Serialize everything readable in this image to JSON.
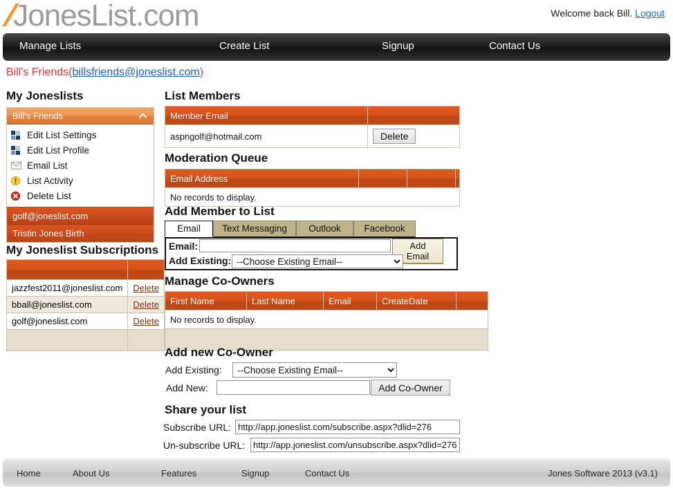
{
  "header": {
    "logo_slash": "/",
    "logo_name": "JonesList.com",
    "welcome_text": "Welcome back Bill.",
    "logout_label": "Logout"
  },
  "nav": {
    "items": [
      {
        "label": "Manage Lists"
      },
      {
        "label": "Create List"
      },
      {
        "label": "Signup"
      },
      {
        "label": "Contact Us"
      }
    ]
  },
  "page_title": {
    "name": "Bill's Friends",
    "open_paren": "(",
    "email": "billsfriends@joneslist.com",
    "close_paren": ")"
  },
  "sidebar": {
    "heading": "My Joneslists",
    "accordion": {
      "title": "Bill's Friends",
      "items": [
        {
          "label": "Edit List Settings",
          "icon": "grid-squares-icon"
        },
        {
          "label": "Edit List Profile",
          "icon": "grid-squares-icon"
        },
        {
          "label": "Email List",
          "icon": "envelope-icon"
        },
        {
          "label": "List Activity",
          "icon": "warning-icon"
        },
        {
          "label": "Delete List",
          "icon": "delete-circle-icon"
        }
      ],
      "sub_lists": [
        {
          "label": "golf@joneslist.com"
        },
        {
          "label": "Tristin Jones Birth"
        }
      ]
    },
    "subscriptions": {
      "heading": "My Joneslist Subscriptions",
      "header_email": "",
      "header_action": "",
      "rows": [
        {
          "email": "jazzfest2011@joneslist.com",
          "action": "Delete"
        },
        {
          "email": "bball@joneslist.com",
          "action": "Delete"
        },
        {
          "email": "golf@joneslist.com",
          "action": "Delete"
        }
      ]
    }
  },
  "main": {
    "list_members": {
      "heading": "List Members",
      "columns": [
        "Member Email",
        ""
      ],
      "rows": [
        {
          "email": "aspngolf@hotmail.com",
          "action": "Delete"
        }
      ]
    },
    "moderation_queue": {
      "heading": "Moderation Queue",
      "columns": [
        "Email Address",
        "",
        "",
        ""
      ],
      "empty_text": "No records to display."
    },
    "add_member": {
      "heading": "Add Member to List",
      "tabs": [
        {
          "label": "Email",
          "active": true
        },
        {
          "label": "Text Messaging",
          "active": false
        },
        {
          "label": "Outlook",
          "active": false
        },
        {
          "label": "Facebook",
          "active": false
        }
      ],
      "email_label": "Email:",
      "email_value": "",
      "email_placeholder": "",
      "add_email_button": "Add Email",
      "add_existing_label": "Add Existing:",
      "add_existing_value": "--Choose Existing Email--"
    },
    "co_owners": {
      "heading": "Manage Co-Owners",
      "columns": [
        "First Name",
        "Last Name",
        "Email",
        "CreateDate",
        "",
        ""
      ],
      "empty_text": "No records to display."
    },
    "add_co_owner": {
      "heading": "Add new Co-Owner",
      "add_existing_label": "Add Existing:",
      "add_existing_value": "--Choose Existing Email--",
      "add_new_label": "Add New:",
      "add_new_value": "",
      "add_button": "Add Co-Owner"
    },
    "share": {
      "heading": "Share your list",
      "subscribe_label": "Subscribe URL:",
      "subscribe_url": "http://app.joneslist.com/subscribe.aspx?dlid=276",
      "unsubscribe_label": "Un-subscribe URL:",
      "unsubscribe_url": "http://app.joneslist.com/unsubscribe.aspx?dlid=276"
    }
  },
  "footer": {
    "items": [
      {
        "label": "Home"
      },
      {
        "label": "About Us"
      },
      {
        "label": "Features"
      },
      {
        "label": "Signup"
      },
      {
        "label": "Contact Us"
      }
    ],
    "copyright": "Jones Software 2013 (v3.1)"
  },
  "colors": {
    "accent_orange": "#d5531c",
    "light_orange": "#ec9450",
    "dark_orange": "#c6481a",
    "link_blue": "#1763c6",
    "title_red": "#e8342a",
    "tab_tan": "#beb489",
    "nav_dark": "#1d1d1d"
  }
}
